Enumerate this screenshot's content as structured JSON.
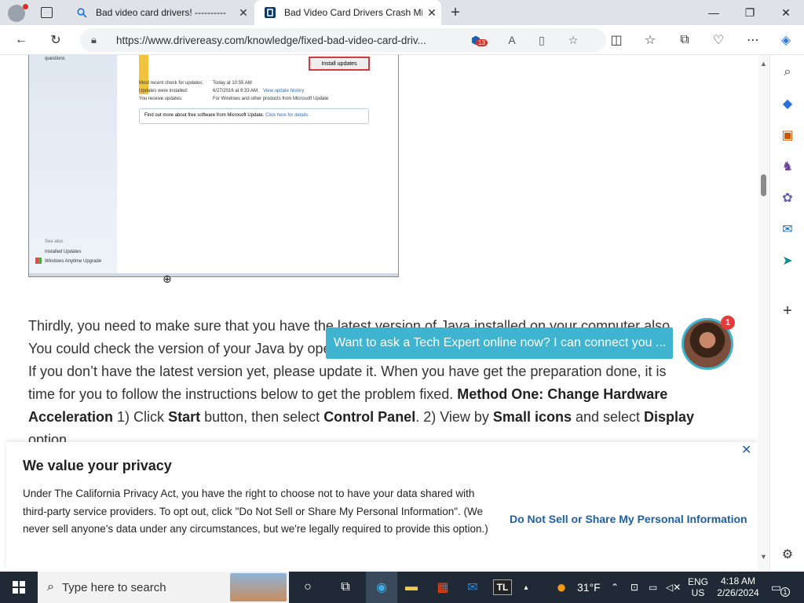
{
  "browser": {
    "tabs": [
      {
        "title": "Bad video card drivers! ----------",
        "icon": "search-icon"
      },
      {
        "title": "Bad Video Card Drivers Crash Mi",
        "icon": "drivereasy-icon"
      }
    ],
    "url": "https://www.drivereasy.com/knowledge/fixed-bad-video-card-driv...",
    "collections_badge": "13"
  },
  "screenshot": {
    "install_updates": "Install updates",
    "left_top": "questions",
    "rows": [
      {
        "label": "Most recent check for updates:",
        "value": "Today at 10:55 AM"
      },
      {
        "label": "Updates were installed:",
        "value": "6/27/2016 at 9:33 AM.",
        "link": "View update history"
      },
      {
        "label": "You receive updates:",
        "value": "For Windows and other products from Microsoft Update"
      }
    ],
    "info_text": "Find out more about free software from Microsoft Update.",
    "info_link": "Click here for details.",
    "see_also": "See also",
    "installed_updates": "Installed Updates",
    "anytime_upgrade": "Windows Anytime Upgrade"
  },
  "article": {
    "line1": "Thirdly, you need to make sure that you have the latest version of Java installed on your computer also.",
    "line2": "You could check the version of your Java by ope",
    "line3": "If you don’t have the latest version yet, please update it.  When you have get the preparation done, it is",
    "line4_a": "time for you to follow the instructions below to get the problem fixed.  ",
    "line4_b": "Method One: Change Hardware",
    "line5_a": "Acceleration",
    "line5_b": " 1) Click ",
    "line5_c": "Start",
    "line5_d": " button, then select ",
    "line5_e": "Control Panel",
    "line5_f": ".  2) View by ",
    "line5_g": "Small icons",
    "line5_h": " and select ",
    "line5_i": "Display",
    "line6": "option."
  },
  "chat": {
    "message": "Want to ask a Tech Expert online now? I can connect you ...",
    "badge": "1"
  },
  "privacy": {
    "title": "We value your privacy",
    "body": "Under The California Privacy Act, you have the right to choose not to have your data shared with third-party service providers. To opt out, click \"Do Not Sell or Share My Personal Information\". (We never sell anyone's data under any circumstances, but we're legally required to provide this option.)",
    "link": "Do Not Sell or Share My Personal Information"
  },
  "taskbar": {
    "search_placeholder": "Type here to search",
    "weather": "31°F",
    "lang1": "ENG",
    "lang2": "US",
    "time": "4:18 AM",
    "date": "2/26/2024",
    "notif_count": "1",
    "tl_label": "TL"
  }
}
